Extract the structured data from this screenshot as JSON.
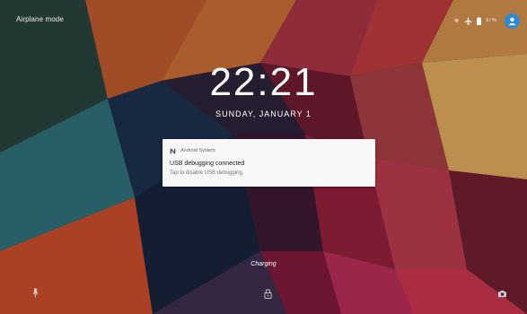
{
  "status_bar": {
    "carrier_text": "Airplane mode",
    "battery_text": "97%",
    "icons": [
      "wifi-off-icon",
      "airplane-icon",
      "battery-icon",
      "user-avatar-icon"
    ]
  },
  "lockscreen": {
    "time": "22:21",
    "date": "SUNDAY, JANUARY 1",
    "charging_text": "Charging"
  },
  "notification": {
    "app_name": "Android System",
    "title": "USB debugging connected",
    "text": "Tap to disable USB debugging."
  },
  "bottom_actions": {
    "left": "voice-assist-icon",
    "center": "lock-icon",
    "right": "camera-icon"
  },
  "colors": {
    "avatar": "#2c88d9",
    "notification_bg": "#f7f7f7"
  }
}
